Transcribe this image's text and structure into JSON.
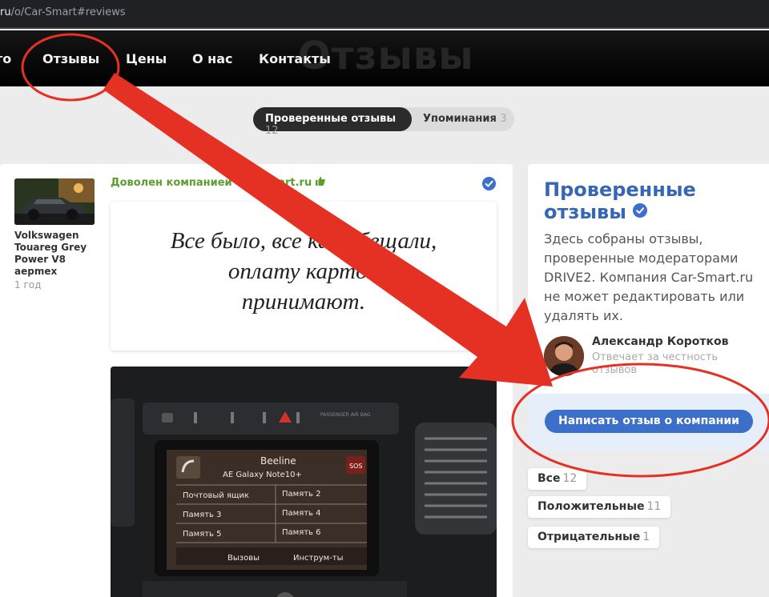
{
  "browser": {
    "url_domain": "ru",
    "url_path": "/o/Car-Smart#reviews"
  },
  "nav": {
    "big_title": "Отзывы",
    "items": [
      "то",
      "Отзывы",
      "Цены",
      "О нас",
      "Контакты"
    ]
  },
  "tabs": {
    "active_label": "Проверенные отзывы",
    "active_count": "12",
    "inactive_label": "Упоминания",
    "inactive_count": "3"
  },
  "review": {
    "car_name": "Volkswagen Touareg Grey Power V8",
    "user": "aepmex",
    "time": "1 год",
    "satisfied_text": "Доволен компанией Car-Smart.ru",
    "quote_line1": "Все было, все как обещали,",
    "quote_line2": "оплату картой",
    "quote_line3": "принимают.",
    "photo": {
      "operator": "Beeline",
      "device": "AE Galaxy Note10+",
      "sos": "SOS",
      "menu_left": [
        "Почтовый ящик",
        "Память 3",
        "Память 5"
      ],
      "menu_right": [
        "Память 2",
        "Память 4",
        "Память 6"
      ],
      "btn_calls": "Вызовы",
      "btn_tools": "Инструм-ты",
      "hazard_label": "PASSENGER AIR BAG"
    }
  },
  "sidebar": {
    "title_line1": "Проверенные",
    "title_line2": "отзывы",
    "description": "Здесь собраны отзывы, проверенные модераторами DRIVE2. Компания Car-Smart.ru не может редактировать или удалять их.",
    "person_name": "Александр Коротков",
    "person_role": "Отвечает за честность отзывов",
    "cta_label": "Написать отзыв о компании"
  },
  "filters": [
    {
      "label": "Все",
      "count": "12"
    },
    {
      "label": "Положительные",
      "count": "11"
    },
    {
      "label": "Отрицательные",
      "count": "1"
    }
  ],
  "colors": {
    "accent_blue": "#3b6fc9",
    "title_blue": "#3567b4",
    "satisfied_green": "#5a9e2f",
    "annotation_red": "#e53024"
  },
  "icons": {
    "verify": "check-circle-icon",
    "thumbs_up": "thumbs-up-icon"
  }
}
